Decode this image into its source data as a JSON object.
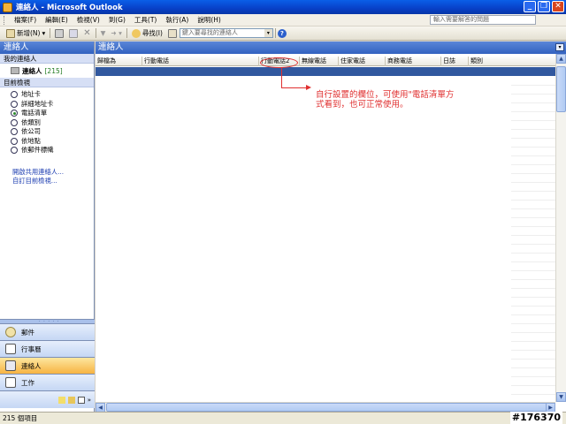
{
  "window": {
    "title": "連絡人 - Microsoft Outlook"
  },
  "menu": {
    "items": [
      "檔案(F)",
      "編輯(E)",
      "檢視(V)",
      "到(G)",
      "工具(T)",
      "執行(A)",
      "說明(H)"
    ],
    "help_placeholder": "輸入需要解答的問題"
  },
  "toolbar": {
    "new_label": "新增(N)",
    "find_label": "尋找(I)",
    "search_placeholder": "鍵入要尋找的連絡人"
  },
  "nav": {
    "header": "連絡人",
    "my_contacts_label": "我的連絡人",
    "contacts_folder": "連絡人",
    "contacts_count": "[215]",
    "current_view_label": "目前檢視",
    "views": [
      {
        "label": "地址卡",
        "selected": false
      },
      {
        "label": "詳細地址卡",
        "selected": false
      },
      {
        "label": "電話清單",
        "selected": true
      },
      {
        "label": "依類別",
        "selected": false
      },
      {
        "label": "依公司",
        "selected": false
      },
      {
        "label": "依地點",
        "selected": false
      },
      {
        "label": "依郵件標幟",
        "selected": false
      }
    ],
    "links": [
      "開啟共用連絡人...",
      "自訂目前檢視..."
    ],
    "buttons": [
      {
        "label": "郵件",
        "active": false
      },
      {
        "label": "行事曆",
        "active": false
      },
      {
        "label": "連絡人",
        "active": true
      },
      {
        "label": "工作",
        "active": false
      }
    ]
  },
  "main": {
    "header": "連絡人",
    "columns": [
      "歸檔為",
      "行動電話",
      "行動電話2",
      "無線電話",
      "住家電話",
      "商務電話",
      "日誌",
      "類別"
    ]
  },
  "annotation": {
    "text": "自行設置的欄位，可使用\"電話清單方式看到，也可正常使用。"
  },
  "status": {
    "text": "215 個項目"
  },
  "watermark": {
    "text": "#176370"
  },
  "colors": {
    "accent": "#3262c0",
    "annotation": "#e03030",
    "active_nav": "#f7b342"
  }
}
